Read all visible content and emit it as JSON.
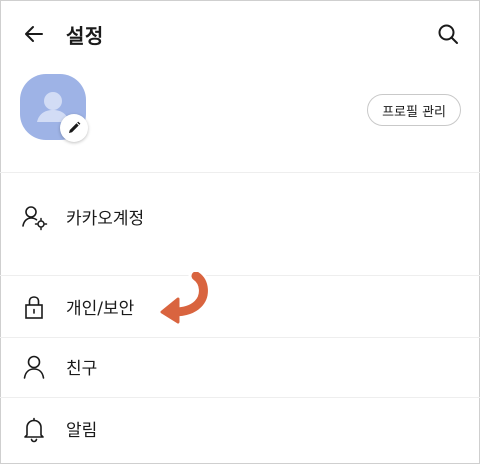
{
  "header": {
    "title": "설정",
    "back_icon": "arrow-left-icon",
    "search_icon": "search-icon"
  },
  "profile": {
    "avatar_color": "#9eb3e6",
    "manage_button_label": "프로필 관리",
    "edit_icon": "pencil-icon"
  },
  "menu": {
    "items": [
      {
        "label": "카카오계정",
        "icon": "account-settings-icon"
      },
      {
        "label": "개인/보안",
        "icon": "lock-icon"
      },
      {
        "label": "친구",
        "icon": "person-icon"
      },
      {
        "label": "알림",
        "icon": "bell-icon"
      }
    ]
  },
  "annotation": {
    "arrow_color": "#d9643f",
    "arrow_icon": "curved-arrow-icon"
  }
}
